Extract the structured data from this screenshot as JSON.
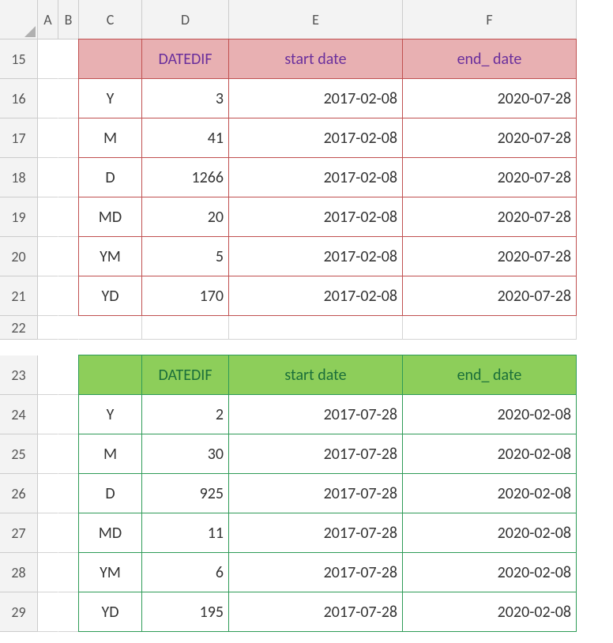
{
  "columns": [
    "A",
    "B",
    "C",
    "D",
    "E",
    "F"
  ],
  "rows": [
    "15",
    "16",
    "17",
    "18",
    "19",
    "20",
    "21",
    "22",
    "23",
    "24",
    "25",
    "26",
    "27",
    "28",
    "29"
  ],
  "section1": {
    "border_color": "#c05050",
    "header_bg": "#e8b0b2",
    "header_fg": "#6a2f9c",
    "headers": {
      "D": "DATEDIF",
      "E": "start date",
      "F": "end_ date"
    },
    "start_date": "2017-02-08",
    "end_date": "2020-07-28",
    "rows": [
      {
        "unit": "Y",
        "value": "3"
      },
      {
        "unit": "M",
        "value": "41"
      },
      {
        "unit": "D",
        "value": "1266"
      },
      {
        "unit": "MD",
        "value": "20"
      },
      {
        "unit": "YM",
        "value": "5"
      },
      {
        "unit": "YD",
        "value": "170"
      }
    ]
  },
  "section2": {
    "border_color": "#2e9b57",
    "header_bg": "#8dce5a",
    "header_fg": "#1b6f3a",
    "headers": {
      "D": "DATEDIF",
      "E": "start date",
      "F": "end_ date"
    },
    "start_date": "2017-07-28",
    "end_date": "2020-02-08",
    "rows": [
      {
        "unit": "Y",
        "value": "2"
      },
      {
        "unit": "M",
        "value": "30"
      },
      {
        "unit": "D",
        "value": "925"
      },
      {
        "unit": "MD",
        "value": "11"
      },
      {
        "unit": "YM",
        "value": "6"
      },
      {
        "unit": "YD",
        "value": "195"
      }
    ]
  }
}
